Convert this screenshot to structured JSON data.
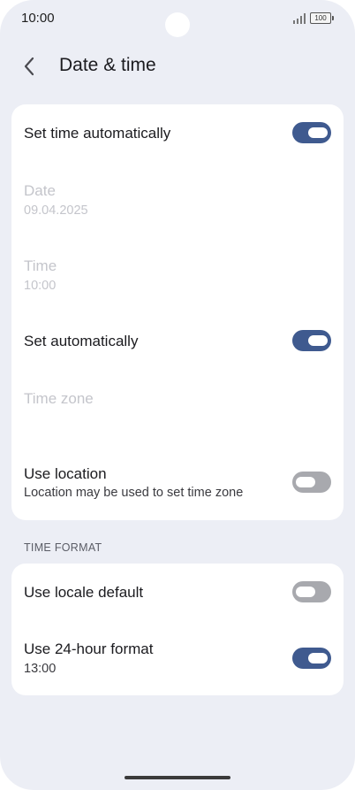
{
  "status_bar": {
    "time": "10:00",
    "battery": "100"
  },
  "header": {
    "title": "Date & time"
  },
  "settings": {
    "set_time_automatically": {
      "label": "Set time automatically",
      "checked": true
    },
    "date": {
      "label": "Date",
      "value": "09.04.2025",
      "enabled": false
    },
    "time": {
      "label": "Time",
      "value": "10:00",
      "enabled": false
    },
    "set_automatically": {
      "label": "Set automatically",
      "checked": true
    },
    "time_zone": {
      "label": "Time zone",
      "enabled": false
    },
    "use_location": {
      "label": "Use location",
      "summary": "Location may be used to set time zone",
      "checked": false
    }
  },
  "time_format": {
    "section_label": "TIME FORMAT",
    "use_locale_default": {
      "label": "Use locale default",
      "checked": false
    },
    "use_24_hour": {
      "label": "Use 24-hour format",
      "summary": "13:00",
      "checked": true
    }
  },
  "colors": {
    "background": "#eceef5",
    "card": "#ffffff",
    "toggle_on": "#3f5a8f",
    "toggle_off": "#a8a9ae",
    "disabled_text": "#c4c5cb"
  },
  "icons": {
    "back": "back-arrow-icon",
    "signal": "cellular-signal-icon",
    "battery": "battery-icon"
  }
}
